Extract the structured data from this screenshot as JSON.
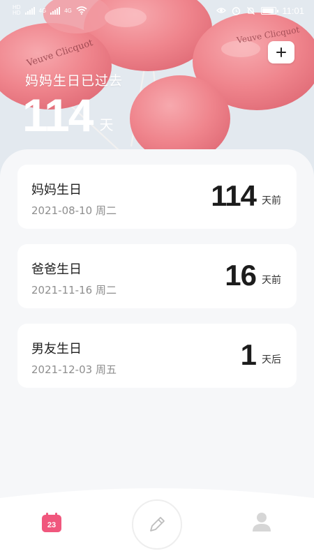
{
  "status_bar": {
    "sim1_label": "HD",
    "sim2_label": "HD",
    "network_1": "4G",
    "network_2": "4G",
    "time": "11:01"
  },
  "hero": {
    "title": "妈妈生日已过去",
    "days": "114",
    "unit": "天",
    "balloon_text": "Veuve Clicquot",
    "accent_color": "#ef7d86"
  },
  "events": [
    {
      "name": "妈妈生日",
      "date": "2021-08-10 周二",
      "count": "114",
      "unit": "天前"
    },
    {
      "name": "爸爸生日",
      "date": "2021-11-16 周二",
      "count": "16",
      "unit": "天前"
    },
    {
      "name": "男友生日",
      "date": "2021-12-03 周五",
      "count": "1",
      "unit": "天后"
    }
  ],
  "bottom_nav": {
    "calendar_badge": "23",
    "calendar_color": "#f0577d",
    "items": [
      "calendar-icon",
      "pen-icon",
      "person-icon"
    ]
  }
}
